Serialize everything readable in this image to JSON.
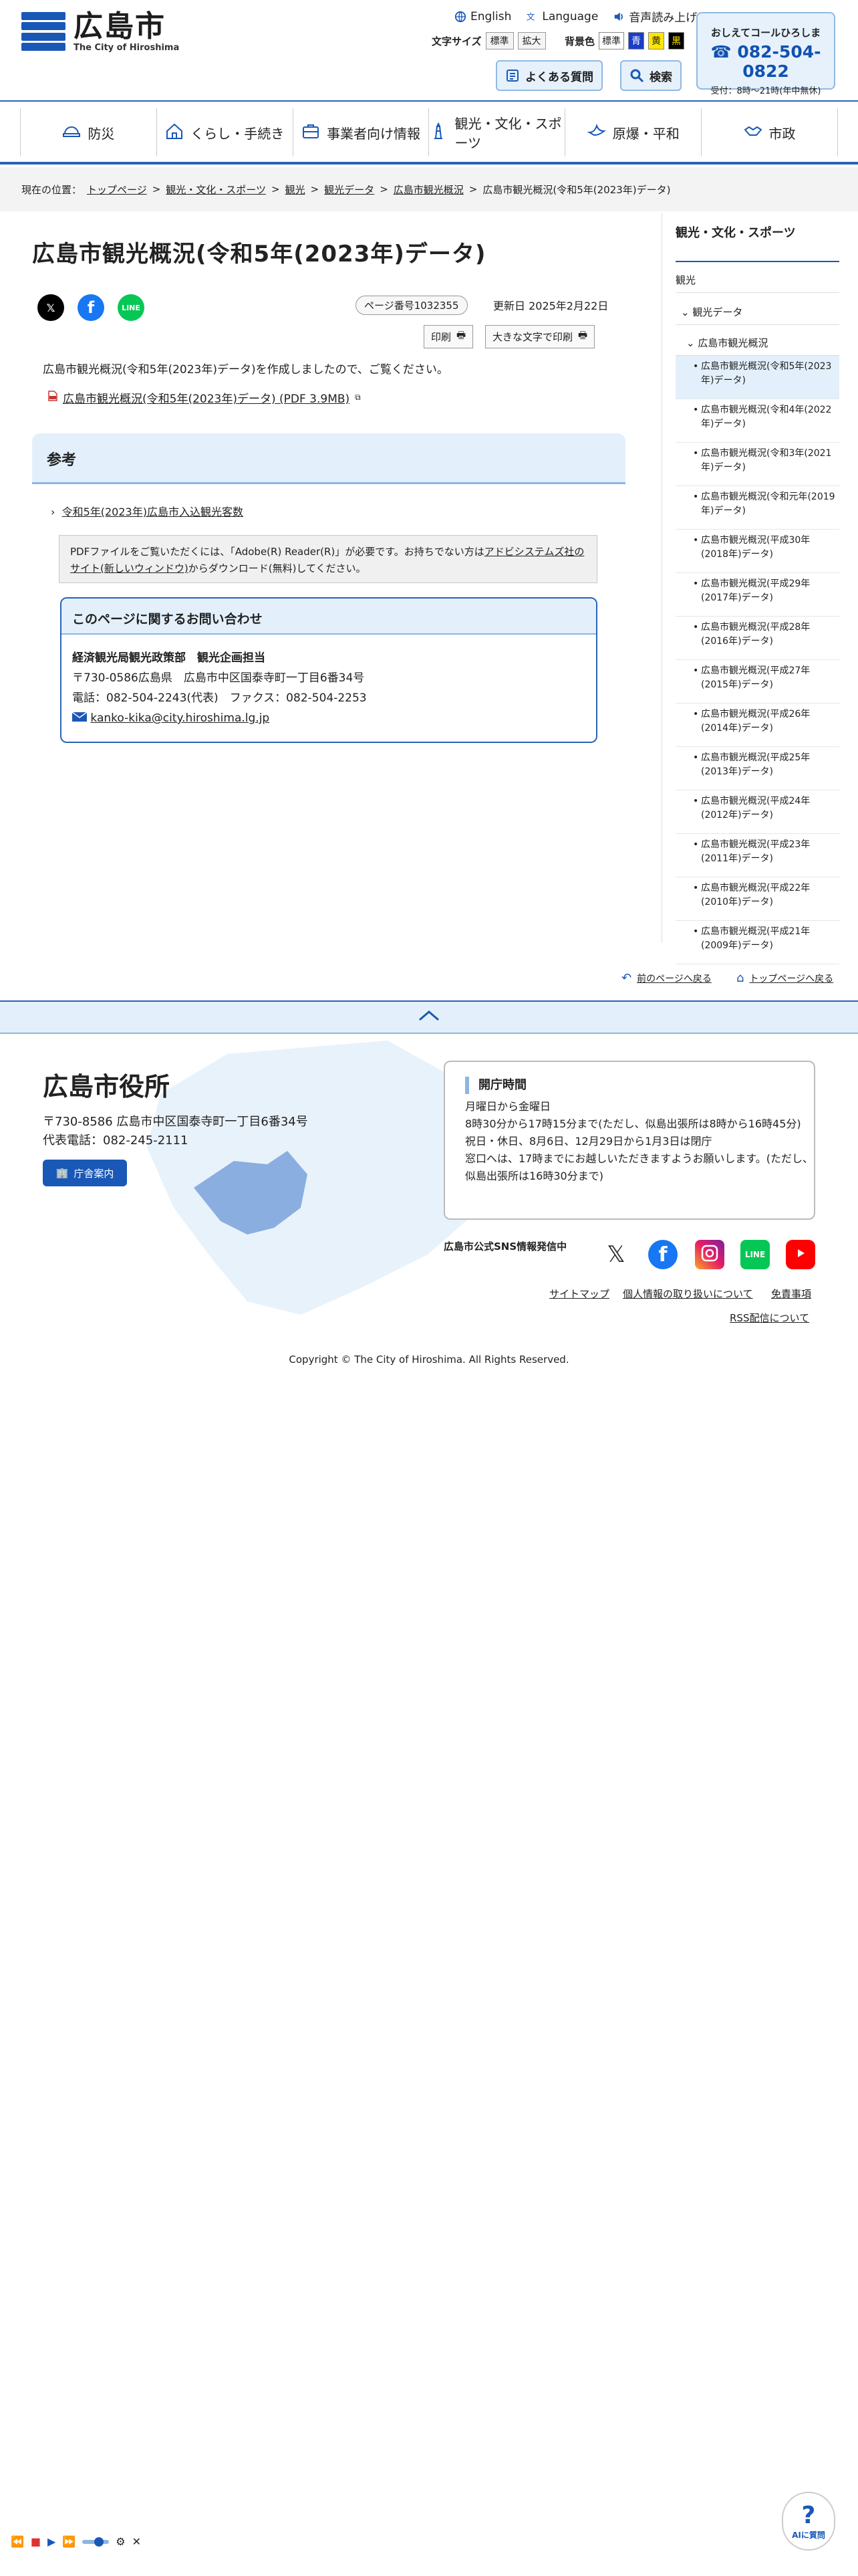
{
  "header": {
    "logo_ja": "広島市",
    "logo_en": "The City of Hiroshima",
    "english": "English",
    "language": "Language",
    "voice": "音声読み上げ",
    "text_size_label": "文字サイズ",
    "text_size_standard": "標準",
    "text_size_large": "拡大",
    "bg_color_label": "背景色",
    "bg_standard": "標準",
    "bg_blue": "青",
    "bg_yellow": "黄",
    "bg_black": "黒",
    "faq": "よくある質問",
    "search": "検索",
    "callcenter_title": "おしえてコールひろしま",
    "callcenter_number": "082-504-0822",
    "callcenter_hours": "受付：8時～21時(年中無休)"
  },
  "nav": [
    {
      "label": "防災",
      "icon": "disaster-helmet-icon"
    },
    {
      "label": "くらし・手続き",
      "icon": "house-icon"
    },
    {
      "label": "事業者向け情報",
      "icon": "briefcase-icon"
    },
    {
      "label": "観光・文化・スポーツ",
      "icon": "tower-icon"
    },
    {
      "label": "原爆・平和",
      "icon": "dove-icon"
    },
    {
      "label": "市政",
      "icon": "handshake-icon"
    }
  ],
  "breadcrumb": {
    "prefix": "現在の位置：",
    "items": [
      "トップページ",
      "観光・文化・スポーツ",
      "観光",
      "観光データ",
      "広島市観光概況"
    ],
    "current": "広島市観光概況(令和5年(2023年)データ)"
  },
  "main": {
    "title": "広島市観光概況(令和5年(2023年)データ)",
    "page_number": "ページ番号1032355",
    "updated": "更新日 2025年2月22日",
    "print": "印刷",
    "print_large": "大きな文字で印刷",
    "intro": "広島市観光概況(令和5年(2023年)データ)を作成しましたので、ご覧ください。",
    "pdf_link": "広島市観光概況(令和5年(2023年)データ) (PDF 3.9MB)",
    "reference_heading": "参考",
    "reference_link": "令和5年(2023年)広島市入込観光客数",
    "pdf_note_1": "PDFファイルをご覧いただくには、「Adobe(R) Reader(R)」が必要です。お持ちでない方は",
    "pdf_note_link": "アドビシステムズ社のサイト(新しいウィンドウ)",
    "pdf_note_2": "からダウンロード(無料)してください。",
    "contact_heading": "このページに関するお問い合わせ",
    "contact_dept": "経済観光局観光政策部　観光企画担当",
    "contact_addr": "〒730-0586広島県　広島市中区国泰寺町一丁目6番34号",
    "contact_tel": "電話：082-504-2243(代表)　ファクス：082-504-2253",
    "contact_email": "kanko-kika@city.hiroshima.lg.jp"
  },
  "sidebar": {
    "heading": "観光・文化・スポーツ",
    "level1": "観光",
    "level2": "観光データ",
    "level3": "広島市観光概況",
    "items": [
      "広島市観光概況(令和5年(2023年)データ)",
      "広島市観光概況(令和4年(2022年)データ)",
      "広島市観光概況(令和3年(2021年)データ)",
      "広島市観光概況(令和元年(2019年)データ)",
      "広島市観光概況(平成30年(2018年)データ)",
      "広島市観光概況(平成29年(2017年)データ)",
      "広島市観光概況(平成28年(2016年)データ)",
      "広島市観光概況(平成27年(2015年)データ)",
      "広島市観光概況(平成26年(2014年)データ)",
      "広島市観光概況(平成25年(2013年)データ)",
      "広島市観光概況(平成24年(2012年)データ)",
      "広島市観光概況(平成23年(2011年)データ)",
      "広島市観光概況(平成22年(2010年)データ)",
      "広島市観光概況(平成21年(2009年)データ)"
    ]
  },
  "back_links": {
    "prev": "前のページへ戻る",
    "top": "トップページへ戻る"
  },
  "footer": {
    "city_name": "広島市役所",
    "address": "〒730-8586 広島市中区国泰寺町一丁目6番34号",
    "phone": "代表電話：082-245-2111",
    "guide": "庁舎案内",
    "hours_title": "開庁時間",
    "hours_1": "月曜日から金曜日",
    "hours_2": "8時30分から17時15分まで(ただし、似島出張所は8時から16時45分)",
    "hours_3": "祝日・休日、8月6日、12月29日から1月3日は閉庁",
    "hours_4": "窓口へは、17時までにお越しいただきますようお願いします。(ただし、似島出張所は16時30分まで)",
    "sns_label": "広島市公式SNS情報発信中",
    "links": [
      "サイトマップ",
      "個人情報の取り扱いについて",
      "免責事項",
      "RSS配信について"
    ],
    "copyright": "Copyright © The City of Hiroshima. All Rights Reserved."
  },
  "ai_button": "AIに質問",
  "colors": {
    "primary": "#1958b7",
    "light_blue": "#e3f0fb",
    "border_blue": "#8cb6e1"
  }
}
